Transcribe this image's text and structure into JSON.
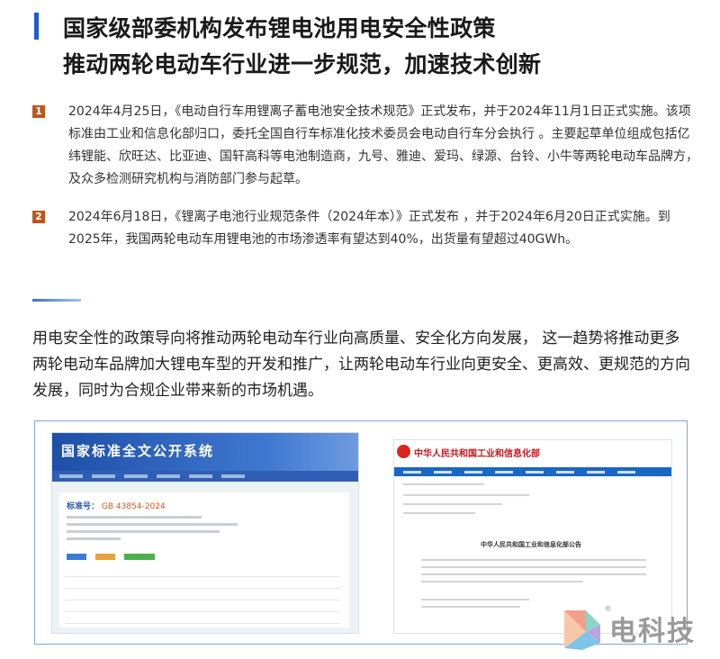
{
  "title": {
    "line1": "国家级部委机构发布锂电池用电安全性政策",
    "line2": "推动两轮电动车行业进一步规范，加速技术创新"
  },
  "items": [
    {
      "number": "1",
      "text": "2024年4月25日，《电动自行车用锂离子蓄电池安全技术规范》正式发布，并于2024年11月1日正式实施。该项标准由工业和信息化部归口，委托全国自行车标准化技术委员会电动自行车分会执行 。主要起草单位组成包括亿纬锂能、欣旺达、比亚迪、国轩高科等电池制造商，九号、雅迪、爱玛、绿源、台铃、小牛等两轮电动车品牌方，及众多检测研究机构与消防部门参与起草。"
    },
    {
      "number": "2",
      "text": "2024年6月18日，《锂离子电池行业规范条件（2024年本）》正式发布 ，并于2024年6月20日正式实施。到2025年，我国两轮电动车用锂电池的市场渗透率有望达到40%，出货量有望超过40GWh。"
    }
  ],
  "summary": "用电安全性的政策导向将推动两轮电动车行业向高质量、安全化方向发展， 这一趋势将推动更多两轮电动车品牌加大锂电车型的开发和推广，让两轮电动车行业向更安全、更高效、更规范的方向发展，同时为合规企业带来新的市场机遇。",
  "screenshot_left": {
    "site_title": "国家标准全文公开系统",
    "standard_label": "标准号：",
    "standard_number": "GB 43854-2024"
  },
  "screenshot_right": {
    "site_title": "中华人民共和国工业和信息化部",
    "doc_title": "中华人民共和国工业和信息化部公告"
  },
  "logo": {
    "text": "电科技",
    "reg": "®"
  },
  "colors": {
    "accent_blue": "#1d5bd8",
    "number_badge": "#c0561e"
  }
}
